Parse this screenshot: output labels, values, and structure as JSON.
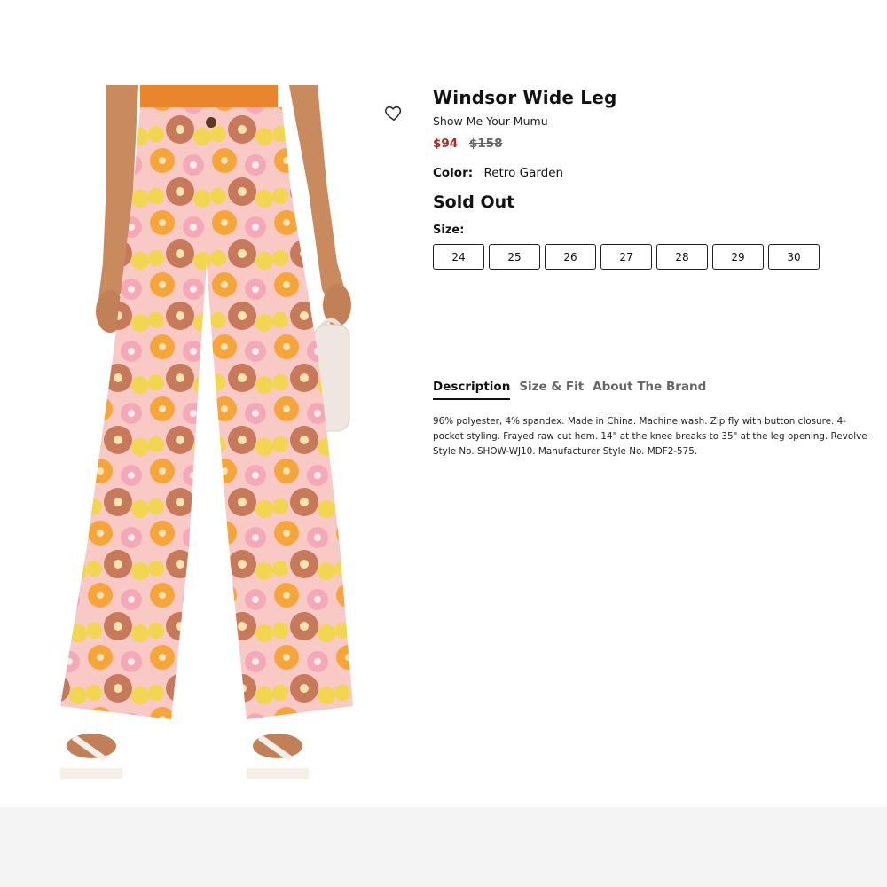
{
  "product": {
    "title": "Windsor Wide Leg",
    "brand": "Show Me Your Mumu",
    "price_sale": "$94",
    "price_original": "$158",
    "color_label": "Color:",
    "color_value": "Retro Garden",
    "availability": "Sold Out",
    "size_label": "Size:",
    "sizes": [
      "24",
      "25",
      "26",
      "27",
      "28",
      "29",
      "30"
    ]
  },
  "tabs": [
    {
      "label": "Description",
      "active": true
    },
    {
      "label": "Size & Fit",
      "active": false
    },
    {
      "label": "About The Brand",
      "active": false
    }
  ],
  "description": "96% polyester, 4% spandex. Made in China. Machine wash. Zip fly with button closure. 4-pocket styling. Frayed raw cut hem. 14\" at the knee breaks to 35\" at the leg opening. Revolve Style No. SHOW-WJ10. Manufacturer Style No. MDF2-575.",
  "icons": {
    "wishlist": "heart-outline-icon"
  },
  "colors": {
    "sale_price": "#b3261e",
    "top": "#e9852c",
    "skin": "#c98a5e",
    "print_pink": "#f4a9b8",
    "print_orange": "#f5a53a",
    "print_yellow": "#f2d550",
    "print_rust": "#c7795c",
    "bag": "#efe7df"
  }
}
